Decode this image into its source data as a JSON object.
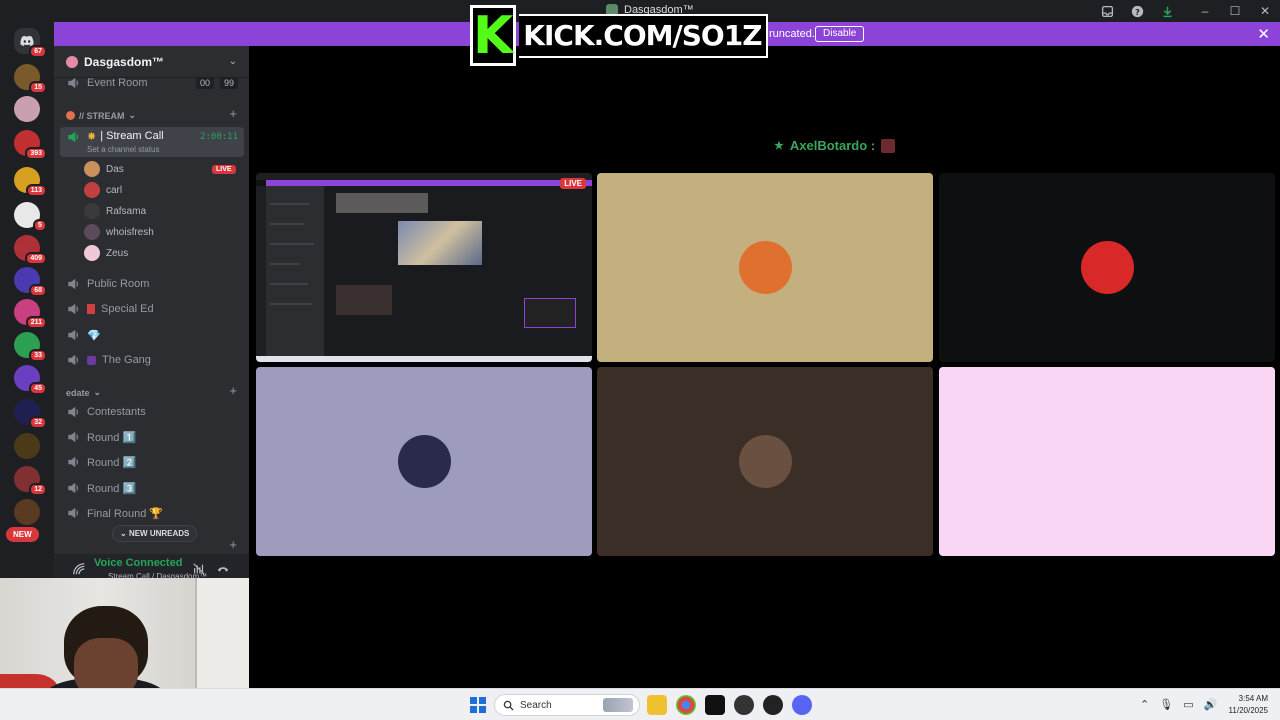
{
  "window": {
    "title": "Dasgasdom™"
  },
  "banner": {
    "text": "runcated.",
    "disable_label": "Disable",
    "close_glyph": "✕"
  },
  "overlay": {
    "kick_logo": "K",
    "kick_text": "KICK.COM/SO1Z"
  },
  "rail": {
    "home_badge": "67",
    "servers": [
      {
        "color": "#7a5a2a",
        "badge": "15"
      },
      {
        "color": "#c8a0b0",
        "badge": ""
      },
      {
        "color": "#c03030",
        "badge": "393"
      },
      {
        "color": "#d8a020",
        "badge": "113"
      },
      {
        "color": "#e8e8e8",
        "badge": "5"
      },
      {
        "color": "#b0303a",
        "badge": "409"
      },
      {
        "color": "#4a3ab0",
        "badge": "68"
      },
      {
        "color": "#c84080",
        "badge": "211"
      },
      {
        "color": "#2aa050",
        "badge": "33"
      },
      {
        "color": "#6a40c0",
        "badge": "45"
      },
      {
        "color": "#202050",
        "badge": "32"
      },
      {
        "color": "#4a3a1a",
        "badge": ""
      },
      {
        "color": "#803030",
        "badge": "12"
      },
      {
        "color": "#5a3a20",
        "badge": ""
      }
    ],
    "new_label": "NEW"
  },
  "guild": {
    "name": "Dasgasdom™"
  },
  "channels": {
    "event_room": {
      "name": "Event Room",
      "count_a": "00",
      "count_b": "99"
    },
    "category_stream": "// STREAM",
    "stream_call": {
      "name": "Stream Call",
      "timer": "2:00:11",
      "status": "Set a channel status"
    },
    "voice_users": [
      {
        "name": "Das",
        "avatar": "#c8905a",
        "live": "LIVE"
      },
      {
        "name": "carl",
        "avatar": "#c04040",
        "live": ""
      },
      {
        "name": "Rafsama",
        "avatar": "#3a3a3a",
        "live": ""
      },
      {
        "name": "whoisfresh",
        "avatar": "#5a4a5a",
        "live": ""
      },
      {
        "name": "Zeus",
        "avatar": "#f0c8d8",
        "live": ""
      }
    ],
    "public_room": "Public Room",
    "special_ed": "Special Ed",
    "diamond_room": "💎",
    "the_gang": "The Gang",
    "category_edate": "edate",
    "contestants": "Contestants",
    "round1": "Round 1️⃣",
    "round2": "Round 2️⃣",
    "round3": "Round 3️⃣",
    "final_round": "Final Round 🏆",
    "new_unreads": "NEW UNREADS"
  },
  "voice_panel": {
    "title": "Voice Connected",
    "subtitle": "Stream Call / Dasgasdom™"
  },
  "stage": {
    "speaker": "AxelBotardo :",
    "tiles": [
      {
        "kind": "screen",
        "bg": "#111214",
        "live": "LIVE"
      },
      {
        "kind": "avatar",
        "bg": "#c4b07e",
        "avatar": "#e07030"
      },
      {
        "kind": "avatar",
        "bg": "#0e0f10",
        "avatar": "#d82828"
      },
      {
        "kind": "avatar",
        "bg": "#9e9cbc",
        "avatar": "#2a2a4a"
      },
      {
        "kind": "avatar",
        "bg": "#3b2e26",
        "avatar": "#6a5040"
      },
      {
        "kind": "avatar",
        "bg": "#f9d6f3",
        "avatar": "#f9d6f3"
      }
    ]
  },
  "taskbar": {
    "search_placeholder": "Search",
    "time": "3:54 AM",
    "date": "11/20/2025"
  }
}
